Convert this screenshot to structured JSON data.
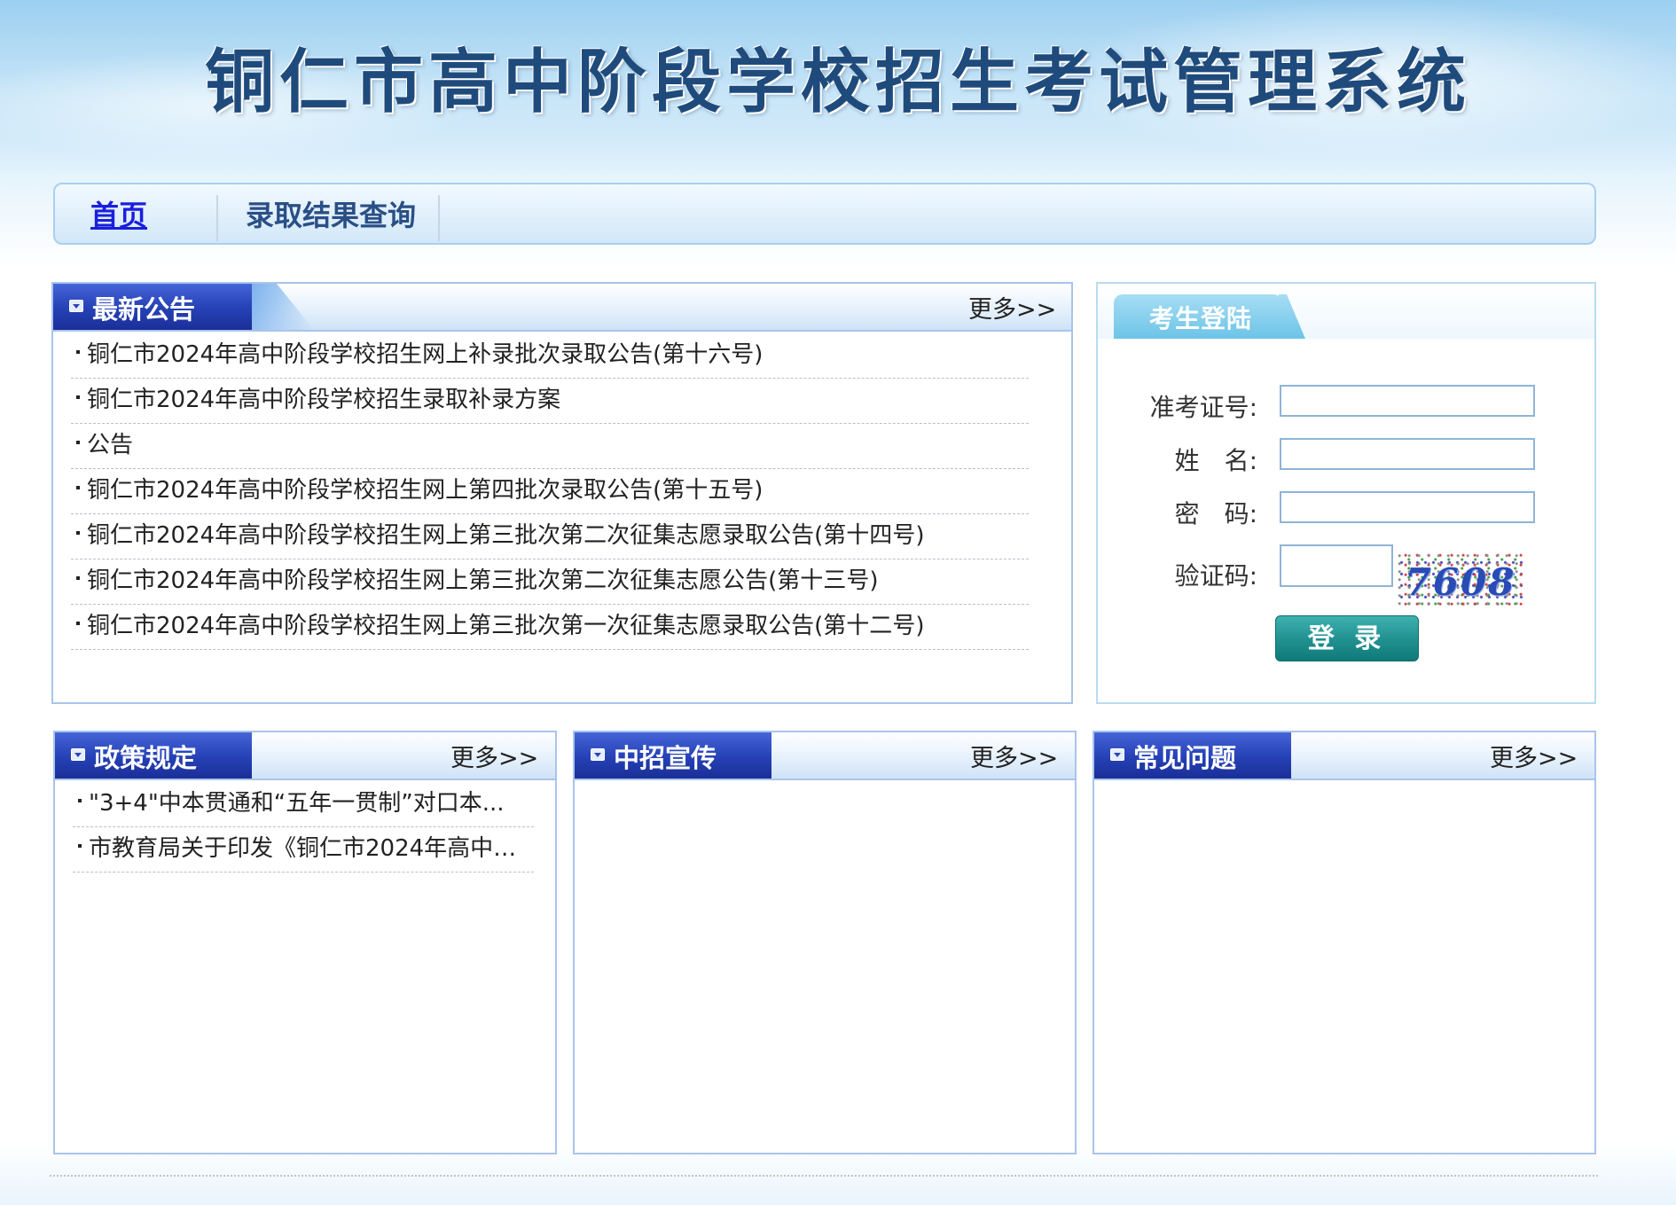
{
  "header": {
    "site_title": "铜仁市高中阶段学校招生考试管理系统"
  },
  "nav": {
    "items": [
      {
        "label": "首页",
        "active": true
      },
      {
        "label": "录取结果查询",
        "active": false
      }
    ]
  },
  "announcements": {
    "title": "最新公告",
    "more": "更多>>",
    "items": [
      "铜仁市2024年高中阶段学校招生网上补录批次录取公告(第十六号)",
      "铜仁市2024年高中阶段学校招生录取补录方案",
      "公告",
      "铜仁市2024年高中阶段学校招生网上第四批次录取公告(第十五号)",
      "铜仁市2024年高中阶段学校招生网上第三批次第二次征集志愿录取公告(第十四号)",
      "铜仁市2024年高中阶段学校招生网上第三批次第二次征集志愿公告(第十三号)",
      "铜仁市2024年高中阶段学校招生网上第三批次第一次征集志愿录取公告(第十二号)"
    ]
  },
  "login": {
    "title": "考生登陆",
    "exam_id_label": "准考证号:",
    "name_label": "姓　名:",
    "password_label": "密　码:",
    "captcha_label": "验证码:",
    "exam_id_value": "",
    "name_value": "",
    "password_value": "",
    "captcha_value": "",
    "captcha_text": "7608",
    "submit_label": "登 录"
  },
  "policy": {
    "title": "政策规定",
    "more": "更多>>",
    "items": [
      "\"3+4\"中本贯通和“五年一贯制”对口本...",
      "市教育局关于印发《铜仁市2024年高中阶..."
    ]
  },
  "publicity": {
    "title": "中招宣传",
    "more": "更多>>",
    "items": []
  },
  "faq": {
    "title": "常见问题",
    "more": "更多>>",
    "items": []
  },
  "colors": {
    "tab_blue": "#2743b8",
    "nav_active": "#1a1fdc",
    "login_button": "#20908f",
    "border": "#a9c4ea"
  },
  "icons": {
    "panel_tab": "collapse-arrow-icon"
  }
}
